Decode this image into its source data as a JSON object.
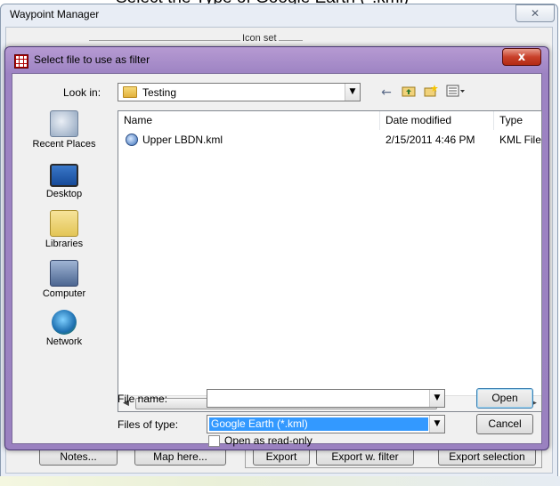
{
  "background_window": {
    "caption_fragment": "Select the Type of Google Earth (*.kml)",
    "title": "Waypoint Manager",
    "close_glyph": "✕",
    "icon_set_label": "Icon set",
    "buttons": {
      "notes": "Notes...",
      "map_here": "Map here...",
      "export": "Export",
      "export_filter": "Export w. filter",
      "export_selection": "Export selection"
    }
  },
  "dialog": {
    "title": "Select file to use as filter",
    "close_glyph": "x",
    "look_in": {
      "label": "Look in:",
      "value": "Testing"
    },
    "places": [
      {
        "label": "Recent Places",
        "icon": "recent-places-icon"
      },
      {
        "label": "Desktop",
        "icon": "desktop-icon"
      },
      {
        "label": "Libraries",
        "icon": "libraries-icon"
      },
      {
        "label": "Computer",
        "icon": "computer-icon"
      },
      {
        "label": "Network",
        "icon": "network-icon"
      }
    ],
    "columns": {
      "name": "Name",
      "date": "Date modified",
      "type": "Type"
    },
    "files": [
      {
        "name": "Upper LBDN.kml",
        "date": "2/15/2011 4:46 PM",
        "type": "KML File",
        "icon": "kml-file-icon"
      }
    ],
    "scroll_thumb_grip": "III",
    "file_name": {
      "label": "File name:",
      "value": ""
    },
    "file_type": {
      "label": "Files of type:",
      "value": "Google Earth (*.kml)"
    },
    "readonly_label": "Open as read-only",
    "readonly_checked": false,
    "open_label": "Open",
    "cancel_label": "Cancel",
    "dropdown_glyph": "▼"
  },
  "colors": {
    "dialog_frame": "#9d83c3",
    "selection": "#3399ff",
    "close_button": "#c8402a"
  }
}
